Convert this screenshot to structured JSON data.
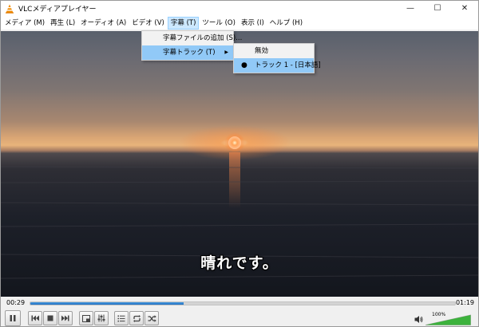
{
  "window": {
    "title": "VLCメディアプレイヤー"
  },
  "window_controls": {
    "minimize": "—",
    "maximize": "☐",
    "close": "✕"
  },
  "menubar": {
    "items": [
      {
        "label": "メディア (M)"
      },
      {
        "label": "再生 (L)"
      },
      {
        "label": "オーディオ (A)"
      },
      {
        "label": "ビデオ (V)"
      },
      {
        "label": "字幕 (T)"
      },
      {
        "label": "ツール (O)"
      },
      {
        "label": "表示 (I)"
      },
      {
        "label": "ヘルプ (H)"
      }
    ]
  },
  "subtitle_menu": {
    "items": [
      {
        "label": "字幕ファイルの追加 (S)..."
      },
      {
        "label": "字幕トラック (T)"
      }
    ]
  },
  "track_menu": {
    "items": [
      {
        "label": "無効"
      },
      {
        "label": "トラック 1 - [日本語]",
        "selected": true
      }
    ]
  },
  "video": {
    "subtitle_text": "晴れです。"
  },
  "playback": {
    "elapsed": "00:29",
    "total": "01:19",
    "progress": 0.36
  },
  "volume": {
    "label": "100%",
    "level": 1.0
  },
  "colors": {
    "accent": "#1e6fbf",
    "menu_highlight": "#91c9f7",
    "volume_green": "#3cb23c"
  }
}
